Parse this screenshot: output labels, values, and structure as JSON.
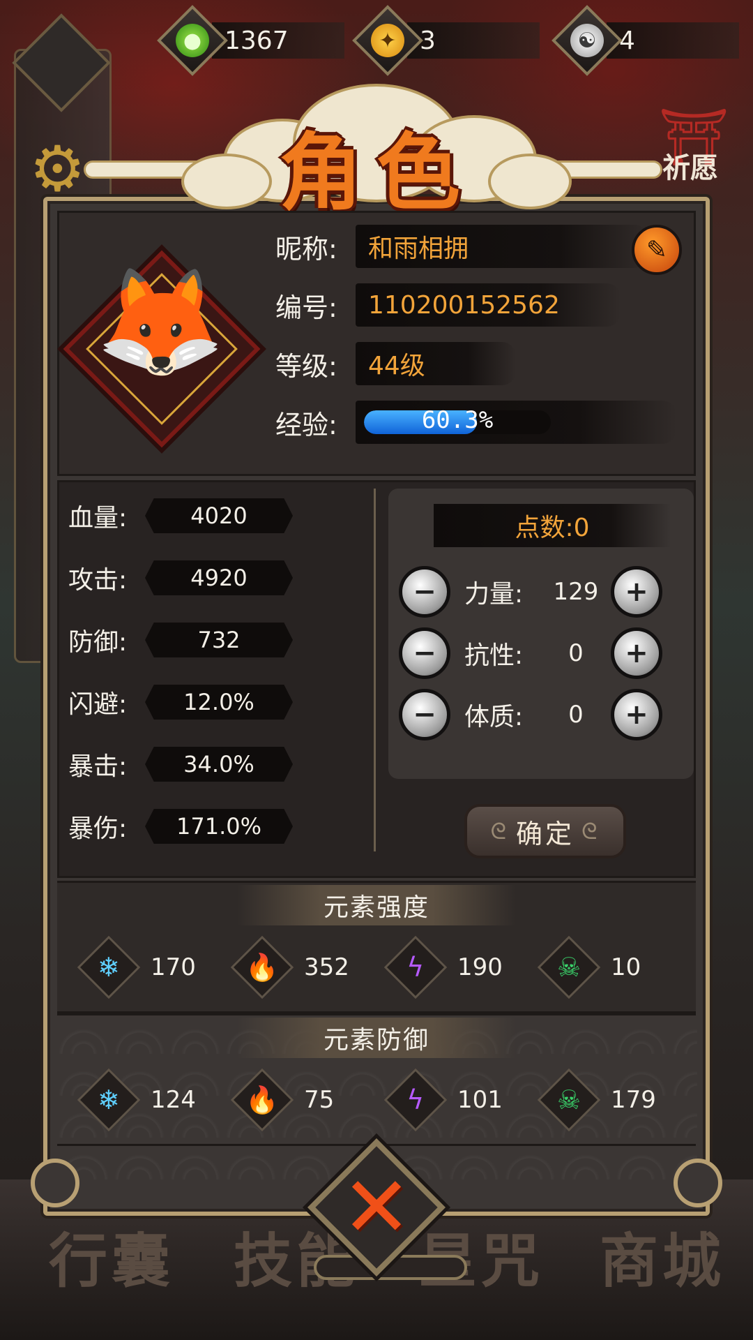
{
  "currencies": [
    {
      "icon": "green-flame-icon",
      "value": "1367"
    },
    {
      "icon": "gold-star-coin-icon",
      "value": "3"
    },
    {
      "icon": "silver-swirl-coin-icon",
      "value": "4"
    }
  ],
  "background": {
    "torii_label": "祈愿",
    "nav_labels": [
      "行囊",
      "技能",
      "星咒",
      "商城"
    ]
  },
  "title": "角色",
  "profile": {
    "nickname_label": "昵称:",
    "nickname": "和雨相拥",
    "id_label": "编号:",
    "id": "110200152562",
    "level_label": "等级:",
    "level": "44级",
    "exp_label": "经验:",
    "exp_text": "60.3%",
    "exp_fraction": 0.603
  },
  "stats": [
    {
      "label": "血量:",
      "value": "4020"
    },
    {
      "label": "攻击:",
      "value": "4920"
    },
    {
      "label": "防御:",
      "value": "732"
    },
    {
      "label": "闪避:",
      "value": "12.0%"
    },
    {
      "label": "暴击:",
      "value": "34.0%"
    },
    {
      "label": "暴伤:",
      "value": "171.0%"
    }
  ],
  "points": {
    "header": "点数:0",
    "attributes": [
      {
        "label": "力量:",
        "value": "129"
      },
      {
        "label": "抗性:",
        "value": "0"
      },
      {
        "label": "体质:",
        "value": "0"
      }
    ],
    "minus_glyph": "−",
    "plus_glyph": "+",
    "confirm_label": "确定"
  },
  "element_strength": {
    "title": "元素强度",
    "items": [
      {
        "icon": "snowflake-icon",
        "value": "170"
      },
      {
        "icon": "fire-icon",
        "value": "352"
      },
      {
        "icon": "lightning-icon",
        "value": "190"
      },
      {
        "icon": "poison-skull-icon",
        "value": "10"
      }
    ]
  },
  "element_defense": {
    "title": "元素防御",
    "items": [
      {
        "icon": "snowflake-icon",
        "value": "124"
      },
      {
        "icon": "fire-icon",
        "value": "75"
      },
      {
        "icon": "lightning-icon",
        "value": "101"
      },
      {
        "icon": "poison-skull-icon",
        "value": "179"
      }
    ]
  },
  "colors": {
    "accent_orange": "#f2a43a",
    "frame_gold": "#b8a073",
    "exp_blue": "#1f8cf0",
    "close_red": "#f05018"
  }
}
